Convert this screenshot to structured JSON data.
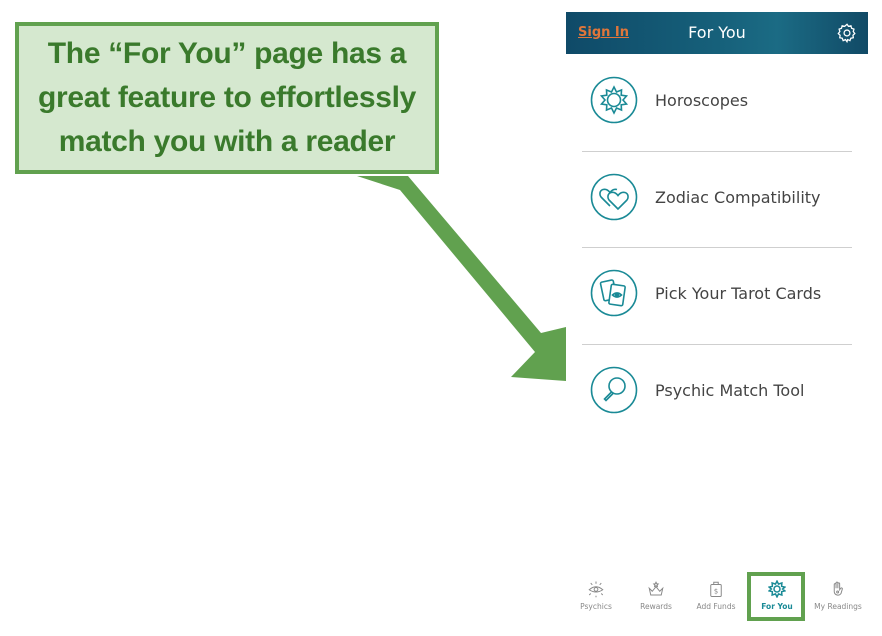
{
  "callout": {
    "text": "The “For You” page has a\ngreat feature to effortlessly\nmatch you with a reader"
  },
  "header": {
    "sign_in": "Sign In",
    "title": "For You",
    "settings_icon": "gear-icon"
  },
  "menu": [
    {
      "label": "Horoscopes",
      "icon": "sun-star-icon"
    },
    {
      "label": "Zodiac Compatibility",
      "icon": "hearts-icon"
    },
    {
      "label": "Pick Your Tarot Cards",
      "icon": "tarot-cards-icon"
    },
    {
      "label": "Psychic Match Tool",
      "icon": "magnifier-icon"
    }
  ],
  "tabs": [
    {
      "label": "Psychics",
      "icon": "eye-icon"
    },
    {
      "label": "Rewards",
      "icon": "crown-icon"
    },
    {
      "label": "Add Funds",
      "icon": "money-bag-icon"
    },
    {
      "label": "For You",
      "icon": "sun-star-icon",
      "active": true
    },
    {
      "label": "My Readings",
      "icon": "hamsa-hand-icon"
    }
  ],
  "colors": {
    "accent": "#1a8a96",
    "sign_in": "#e0763a",
    "callout_border": "#61a14f",
    "callout_fill": "#d5e8cf",
    "callout_text": "#3a7a2c"
  }
}
